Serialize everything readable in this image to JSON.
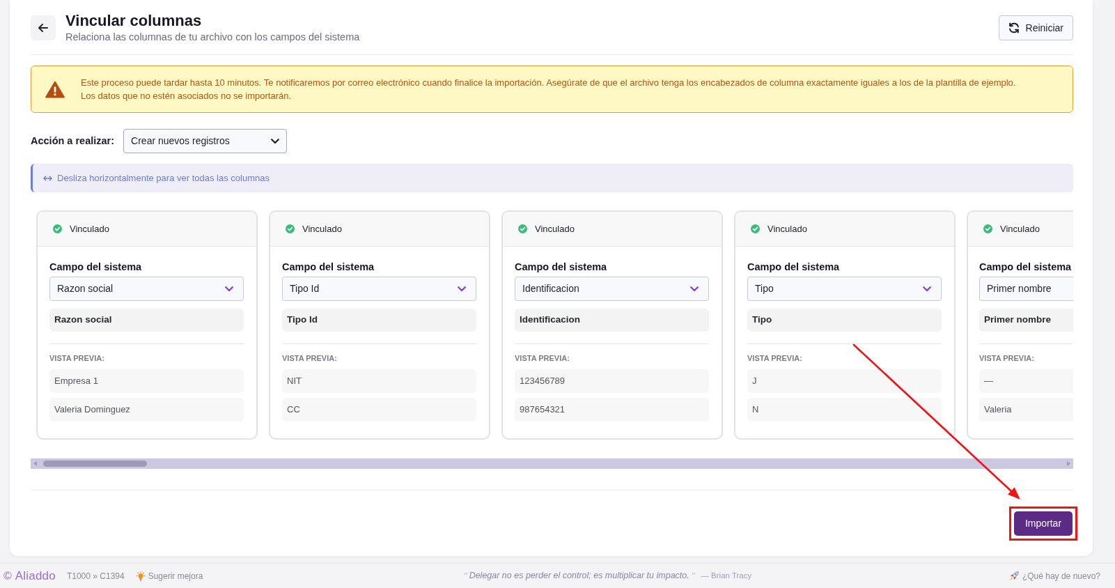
{
  "header": {
    "title": "Vincular columnas",
    "subtitle": "Relaciona las columnas de tu archivo con los campos del sistema",
    "reset_button": "Reiniciar"
  },
  "alert": {
    "kind": "warning",
    "lines": [
      "Este proceso puede tardar hasta 10 minutos. Te notificaremos por correo electrónico cuando finalice la importación. Asegúrate de que el archivo tenga los encabezados de columna exactamente iguales a los de la plantilla de ejemplo.",
      "Los datos que no estén asociados no se importarán."
    ]
  },
  "action": {
    "label": "Acción a realizar:",
    "value": "Crear nuevos registros"
  },
  "hint": "Desliza horizontalmente para ver todas las columnas",
  "columns": [
    {
      "status": {
        "label": "Vinculado",
        "linked": true
      },
      "field_label": "Campo del sistema",
      "selected_field": "Razon social",
      "source_column": "Razon social",
      "preview_label": "VISTA PREVIA:",
      "preview": [
        "Empresa 1",
        "Valeria Dominguez"
      ]
    },
    {
      "status": {
        "label": "Vinculado",
        "linked": true
      },
      "field_label": "Campo del sistema",
      "selected_field": "Tipo Id",
      "source_column": "Tipo Id",
      "preview_label": "VISTA PREVIA:",
      "preview": [
        "NIT",
        "CC"
      ]
    },
    {
      "status": {
        "label": "Vinculado",
        "linked": true
      },
      "field_label": "Campo del sistema",
      "selected_field": "Identificacion",
      "source_column": "Identificacion",
      "preview_label": "VISTA PREVIA:",
      "preview": [
        "123456789",
        "987654321"
      ]
    },
    {
      "status": {
        "label": "Vinculado",
        "linked": true
      },
      "field_label": "Campo del sistema",
      "selected_field": "Tipo",
      "source_column": "Tipo",
      "preview_label": "VISTA PREVIA:",
      "preview": [
        "J",
        "N"
      ]
    },
    {
      "status": {
        "label": "Vinculado",
        "linked": true
      },
      "field_label": "Campo del sistema",
      "selected_field": "Primer nombre",
      "source_column": "Primer nombre",
      "preview_label": "VISTA PREVIA:",
      "preview": [
        "—",
        "Valeria"
      ]
    }
  ],
  "import_button": "Importar",
  "footer": {
    "copyright": "©",
    "brand": "Aliaddo",
    "breadcrumb": "T1000 » C1394",
    "suggest": "Sugerir mejora",
    "quote": {
      "open_mark": "\"",
      "text": "Delegar no es perder el control; es multiplicar tu impacto.",
      "close_mark": "\"",
      "author": "— Brian Tracy"
    },
    "whats_new": "¿Qué hay de nuevo?"
  }
}
